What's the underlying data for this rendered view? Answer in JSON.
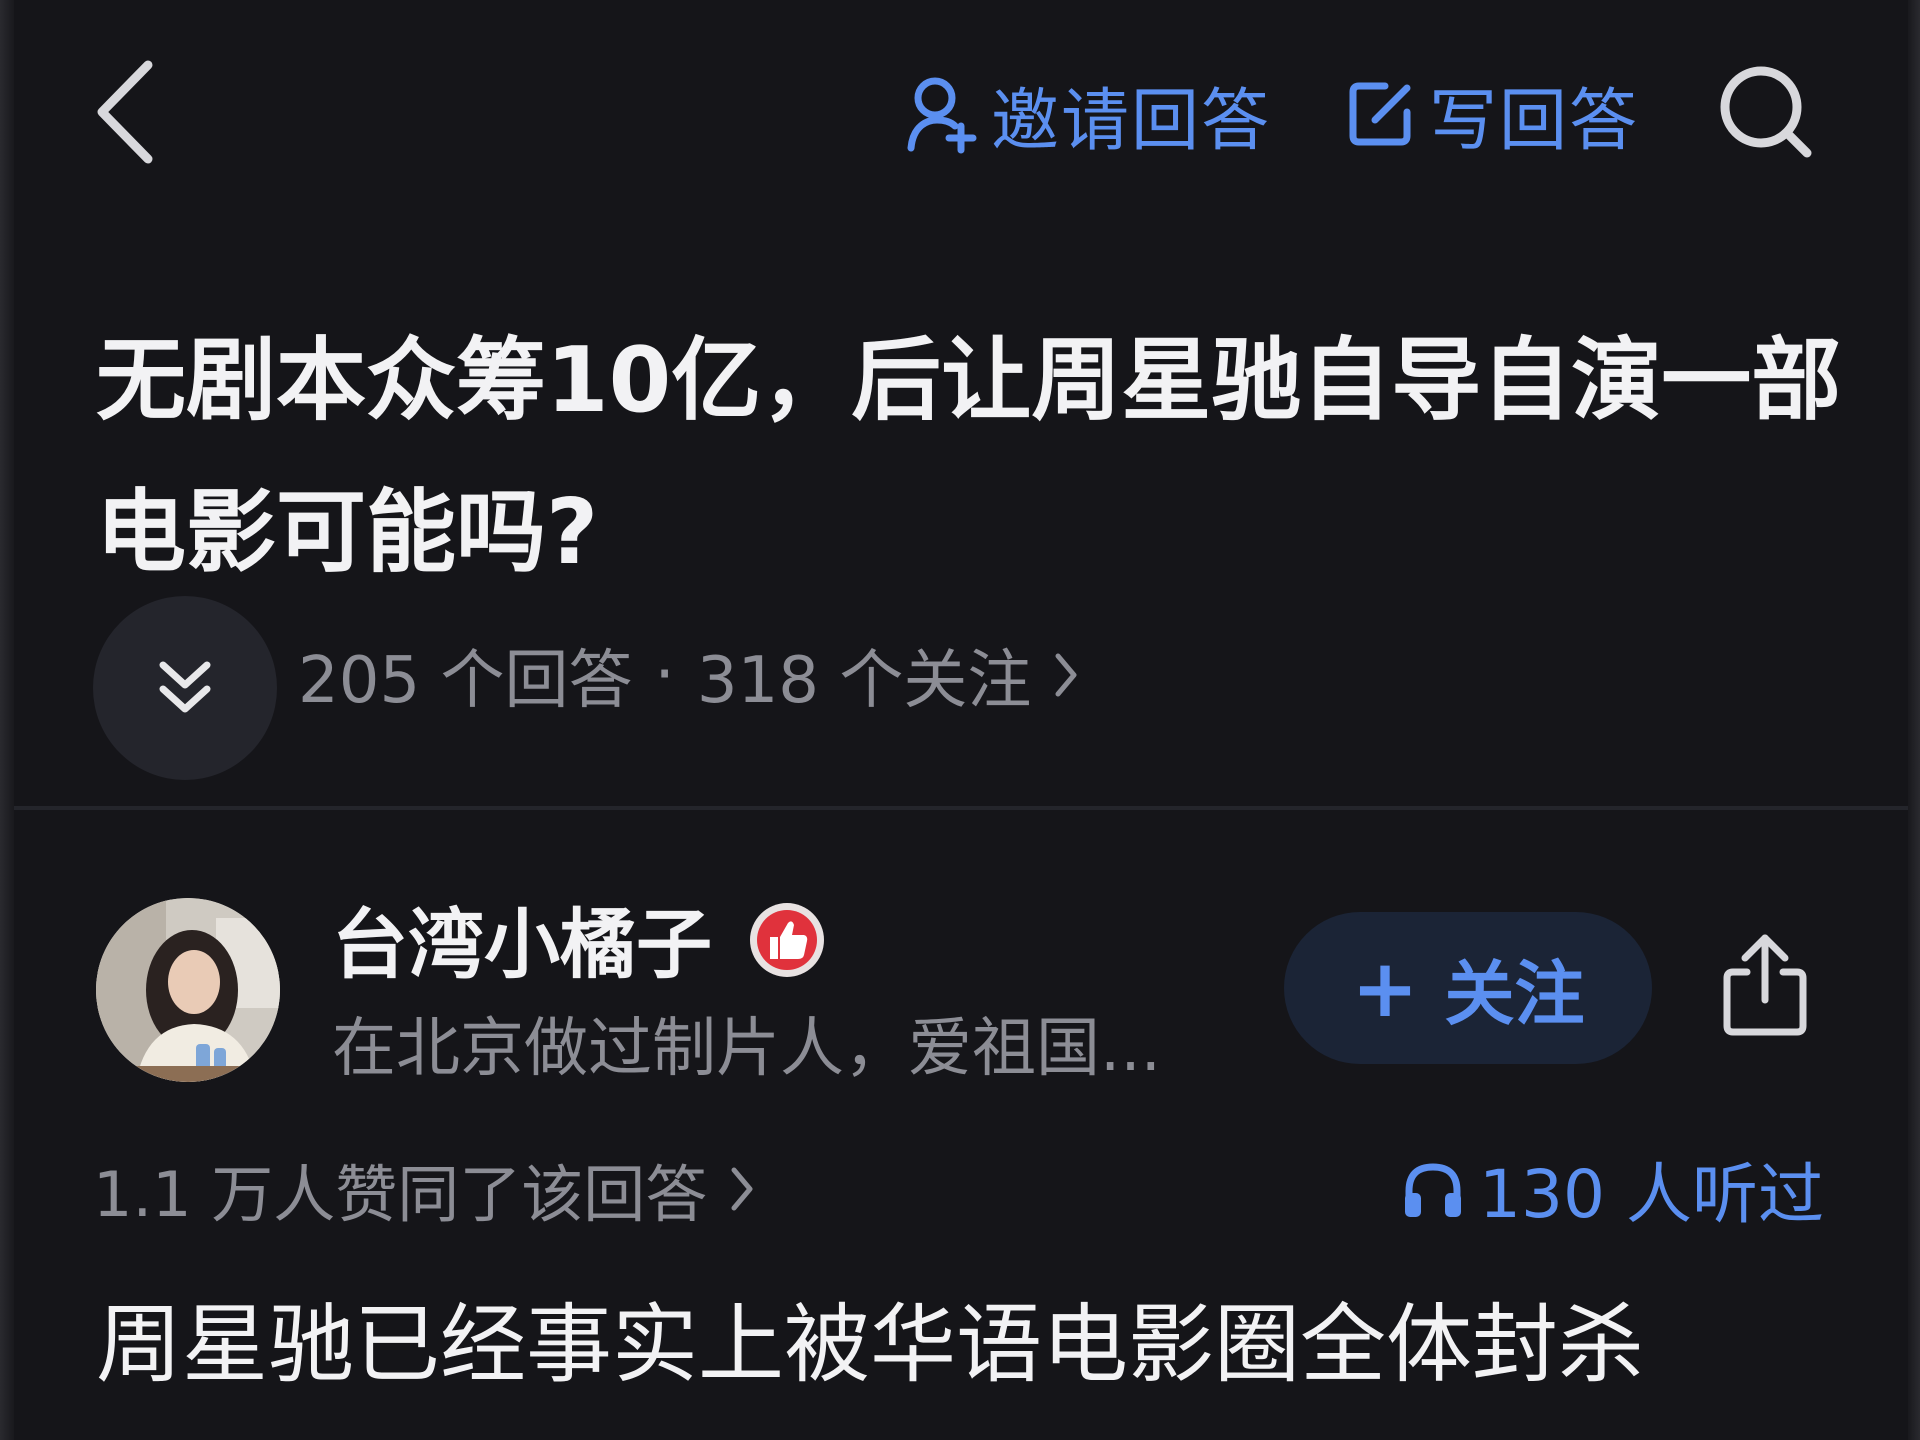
{
  "nav": {
    "invite_label": "邀请回答",
    "write_label": "写回答"
  },
  "question": {
    "title": "无剧本众筹10亿，后让周星驰自导自演一部电影可能吗?",
    "answers_count": "205 个回答",
    "separator": "·",
    "followers_count": "318 个关注"
  },
  "author": {
    "name": "台湾小橘子",
    "bio": "在北京做过制片人，爱祖国...",
    "follow_label": "关注",
    "follow_plus": "+"
  },
  "stats": {
    "votes": "1.1 万人赞同了该回答",
    "listened": "130 人听过"
  },
  "answer": {
    "text": "周星驰已经事实上被华语电影圈全体封杀"
  },
  "colors": {
    "background": "#151519",
    "accent": "#5b8ff0",
    "muted_text": "#8c8d95",
    "primary_text": "#f2f2f4",
    "follow_bg": "#1b2436",
    "badge_red": "#e0323c"
  },
  "icons": [
    "back-arrow-icon",
    "invite-user-icon",
    "edit-icon",
    "search-icon",
    "double-chevron-down-icon",
    "chevron-right-icon",
    "thumbs-up-badge-icon",
    "share-icon",
    "headphones-icon"
  ]
}
